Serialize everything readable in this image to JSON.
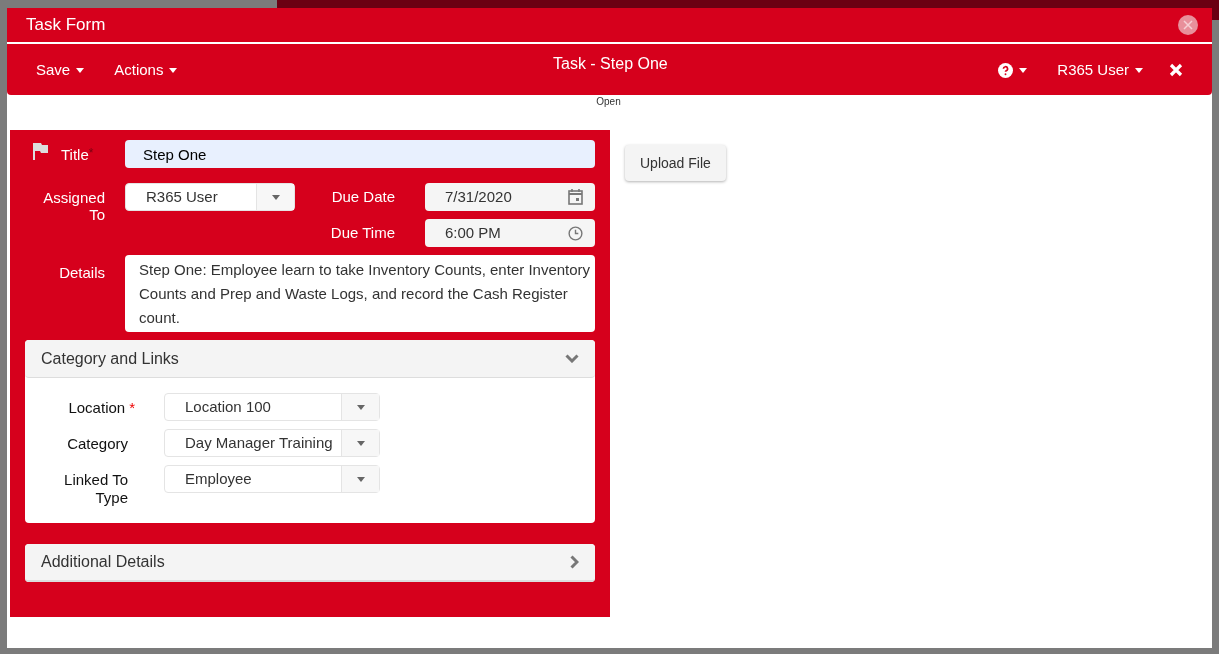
{
  "window": {
    "title": "Task Form"
  },
  "toolbar": {
    "menus": [
      "Save",
      "Actions"
    ],
    "title": "Task - Step One",
    "user_menu": "R365 User"
  },
  "status": "Open",
  "form": {
    "title_field": {
      "label": "Title",
      "required_mark": "*",
      "value": "Step One"
    },
    "assigned_to": {
      "label": "Assigned To",
      "value": "R365 User"
    },
    "due_date": {
      "label": "Due Date",
      "value": "7/31/2020"
    },
    "due_time": {
      "label": "Due Time",
      "value": "6:00 PM"
    },
    "details": {
      "label": "Details",
      "value": "Step One: Employee learn to take Inventory Counts, enter Inventory Counts and Prep and Waste Logs, and record the Cash Register count."
    },
    "sections": [
      {
        "title": "Category and Links",
        "expanded": true,
        "fields": [
          {
            "label": "Location",
            "required_mark": "*",
            "value": "Location 100"
          },
          {
            "label": "Category",
            "value": "Day Manager Training"
          },
          {
            "label": "Linked To Type",
            "value": "Employee"
          }
        ]
      },
      {
        "title": "Additional Details",
        "expanded": false
      }
    ]
  },
  "upload_button": "Upload File"
}
